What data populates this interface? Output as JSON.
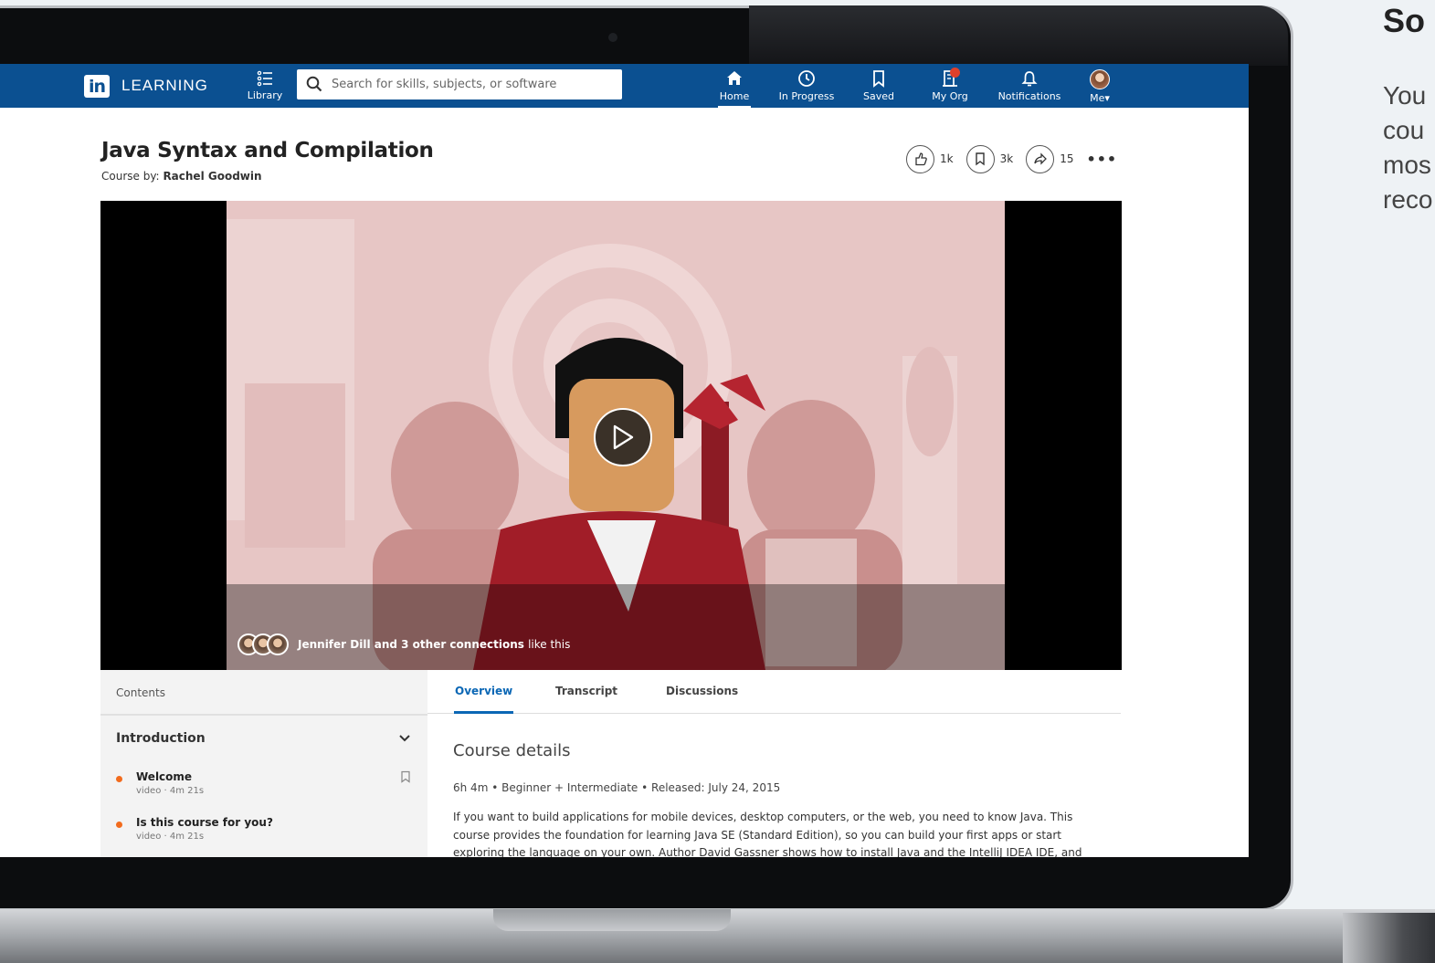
{
  "navbar": {
    "logo_mark": "in",
    "logo_text": "LEARNING",
    "library_label": "Library",
    "search_placeholder": "Search for skills, subjects, or software",
    "items": [
      {
        "label": "Home",
        "icon": "home-icon",
        "active": true
      },
      {
        "label": "In Progress",
        "icon": "clock-icon"
      },
      {
        "label": "Saved",
        "icon": "bookmark-icon"
      },
      {
        "label": "My Org",
        "icon": "building-icon"
      },
      {
        "label": "Notifications",
        "icon": "bell-icon"
      },
      {
        "label": "Me▾",
        "icon": "avatar"
      }
    ],
    "brand_color": "#0b5091"
  },
  "course": {
    "title": "Java Syntax and Compilation",
    "by_prefix": "Course by:",
    "author": "Rachel Goodwin",
    "likes": "1k",
    "saves": "3k",
    "shares": "15"
  },
  "video": {
    "social_names": "Jennifer Dill and 3 other connections",
    "social_suffix": "like this"
  },
  "contents": {
    "label": "Contents",
    "section": "Introduction",
    "lessons": [
      {
        "name": "Welcome",
        "type": "video",
        "duration": "4m 21s"
      },
      {
        "name": "Is this course for you?",
        "type": "video",
        "duration": "4m 21s"
      }
    ]
  },
  "tabs": [
    "Overview",
    "Transcript",
    "Discussions"
  ],
  "details": {
    "title": "Course details",
    "duration": "6h 4m",
    "level": "Beginner + Intermediate",
    "released": "Released: July 24, 2015",
    "description": "If you want to build applications for mobile devices, desktop computers, or the web, you need to know Java. This course provides the foundation for learning Java SE (Standard Edition), so you can build your first apps or start exploring the language on your own. Author David Gassner shows how to install Java and the IntelliJ IDEA IDE, and"
  },
  "side": {
    "heading": "So",
    "lines": [
      "You",
      "cou",
      "mos",
      "reco"
    ]
  },
  "colors": {
    "accent": "#0b67b5",
    "lesson_dot": "#f26b1d",
    "badge": "#e0402b"
  }
}
